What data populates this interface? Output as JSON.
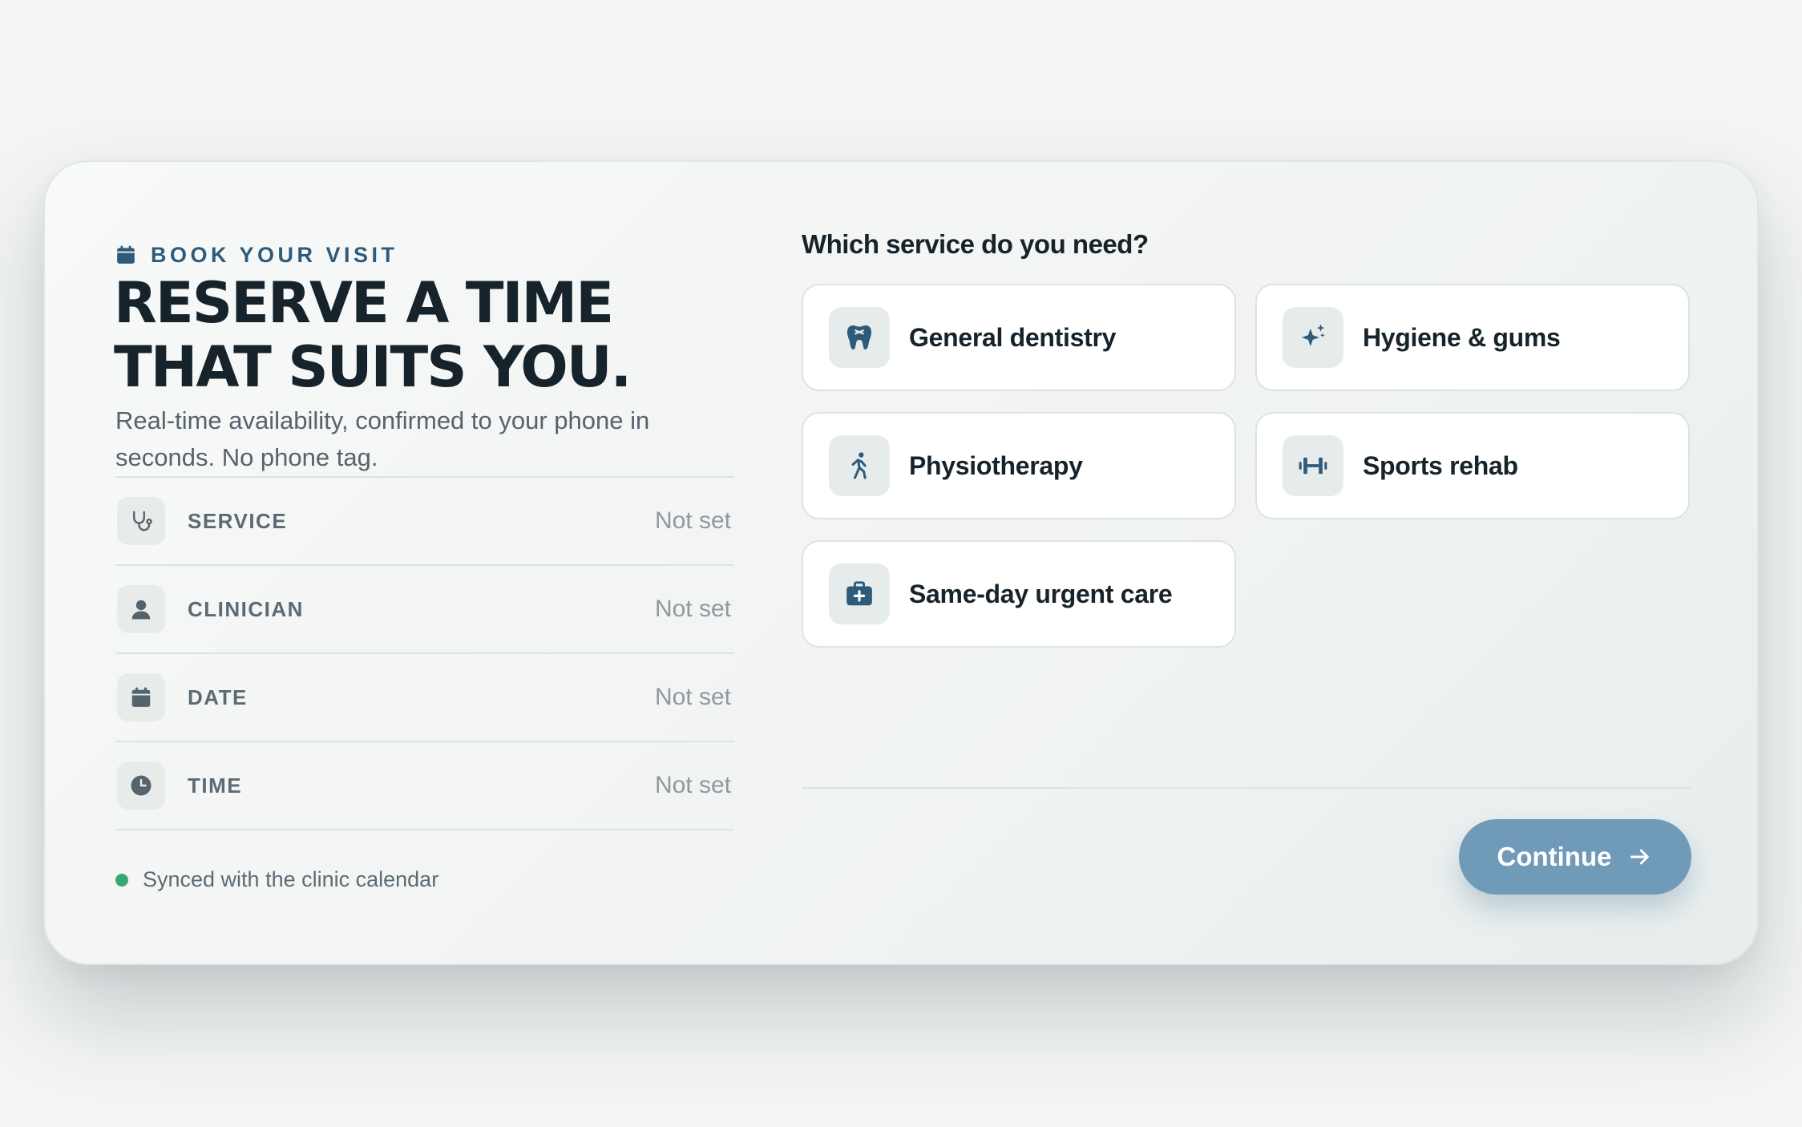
{
  "booking": {
    "eyebrow": "BOOK YOUR VISIT",
    "headline_line1": "RESERVE A TIME",
    "headline_line2": "THAT SUITS YOU.",
    "subtext": "Real-time availability, confirmed to your phone in seconds. No phone tag.",
    "summary": [
      {
        "label": "SERVICE",
        "value": "Not set",
        "icon": "stethoscope-icon"
      },
      {
        "label": "CLINICIAN",
        "value": "Not set",
        "icon": "person-icon"
      },
      {
        "label": "DATE",
        "value": "Not set",
        "icon": "calendar-icon"
      },
      {
        "label": "TIME",
        "value": "Not set",
        "icon": "clock-icon"
      }
    ],
    "sync_status": "Synced with the clinic calendar"
  },
  "services": {
    "question": "Which service do you need?",
    "options": [
      {
        "name": "General dentistry",
        "icon": "tooth-icon"
      },
      {
        "name": "Hygiene & gums",
        "icon": "sparkle-icon"
      },
      {
        "name": "Physiotherapy",
        "icon": "walking-person-icon"
      },
      {
        "name": "Sports rehab",
        "icon": "dumbbell-icon"
      },
      {
        "name": "Same-day urgent care",
        "icon": "first-aid-kit-icon"
      }
    ]
  },
  "actions": {
    "continue_label": "Continue"
  },
  "colors": {
    "accent": "#2f5b7b",
    "button": "#6f9ab8",
    "sync_dot": "#37a86e",
    "icon_muted": "#55636c"
  }
}
